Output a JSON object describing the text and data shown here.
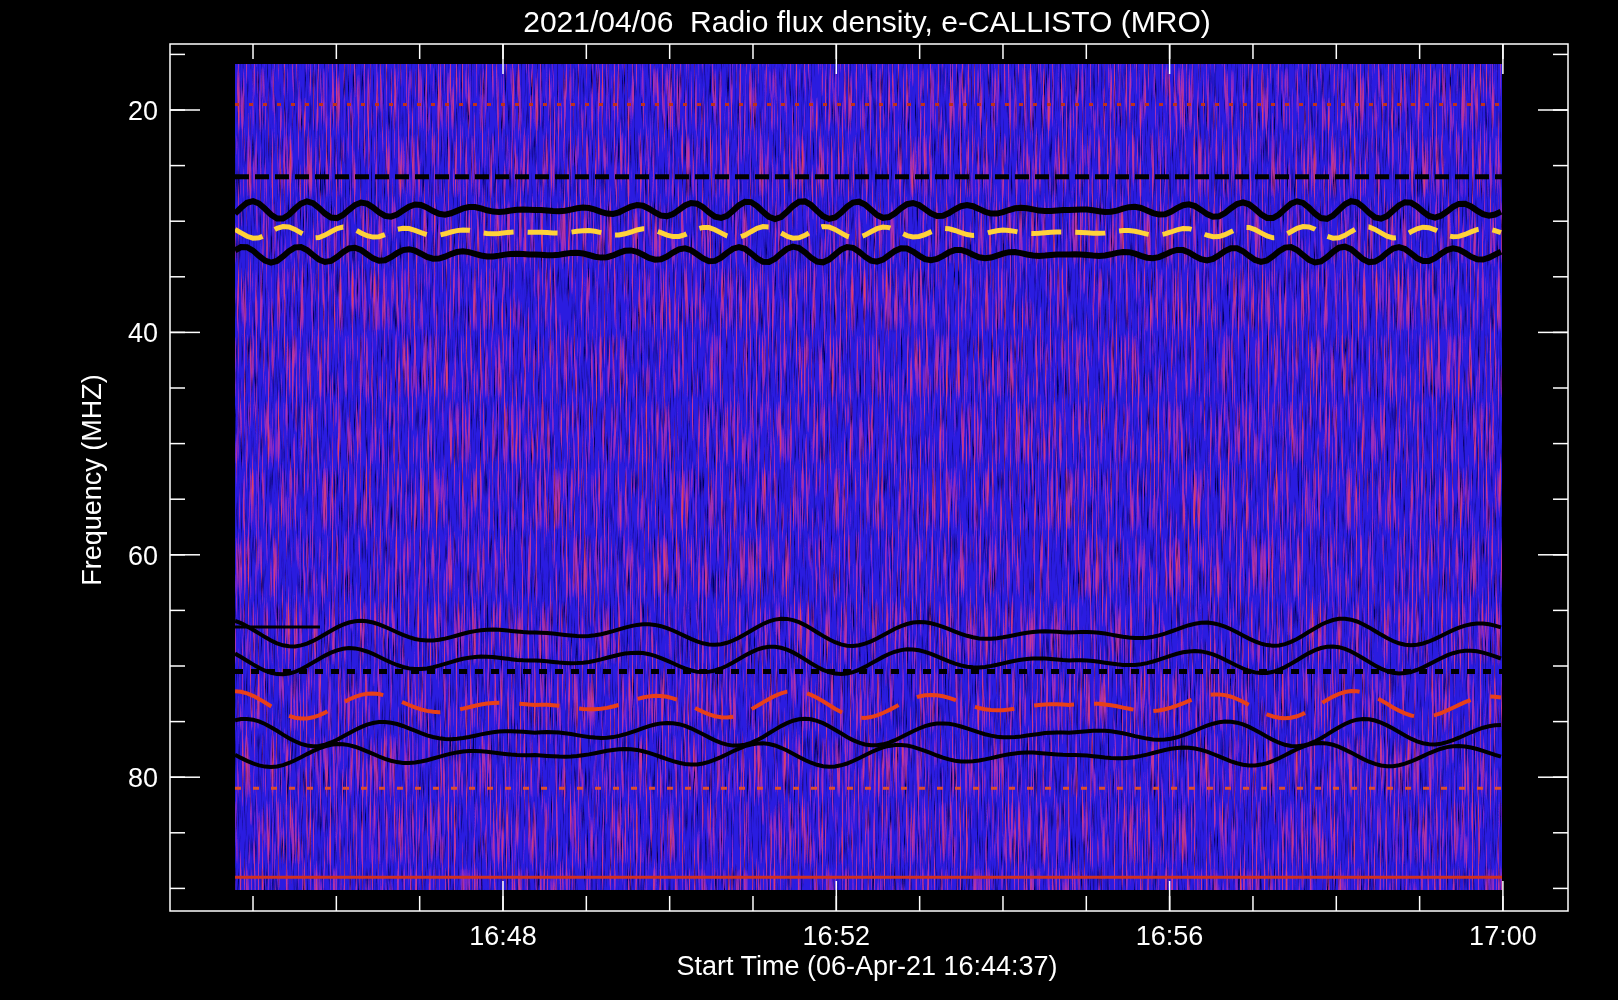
{
  "title": "2021/04/06  Radio flux density, e-CALLISTO (MRO)",
  "y_axis": {
    "label": "Frequency (MHZ)",
    "ticks": [
      "20",
      "40",
      "60",
      "80"
    ]
  },
  "x_axis": {
    "label": "Start Time (06-Apr-21 16:44:37)",
    "ticks": [
      "16:48",
      "16:52",
      "16:56",
      "17:00"
    ]
  }
}
